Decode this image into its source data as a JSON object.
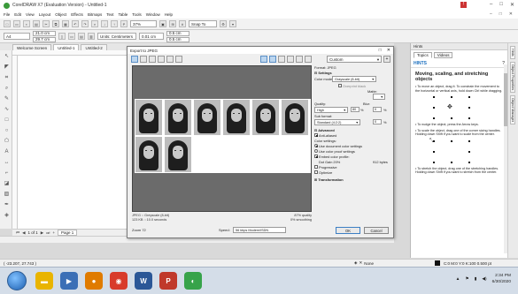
{
  "window": {
    "title": "CorelDRAW X7 (Evaluation Version) - Untitled-1",
    "controls": [
      "–",
      "□",
      "✕"
    ],
    "doc_controls": [
      "–",
      "□",
      "✕"
    ]
  },
  "menu": [
    "File",
    "Edit",
    "View",
    "Layout",
    "Object",
    "Effects",
    "Bitmaps",
    "Text",
    "Table",
    "Tools",
    "Window",
    "Help"
  ],
  "toolbar": {
    "zoom": "37%",
    "snap_to": "Snap To",
    "page_size": "A4",
    "width": "21.0 cm",
    "height": "29.7 cm",
    "units": "Units: Centimeters",
    "nudge": "0.01 cm",
    "dup_x": "0.5 cm",
    "dup_y": "0.5 cm"
  },
  "doc_tabs": [
    "Welcome Screen",
    "Untitled-1",
    "Untitled-2"
  ],
  "page_nav": {
    "position": "1 of 1",
    "page_tab": "Page 1"
  },
  "status": {
    "coords": "( -23.207, 27.743 )",
    "fill": "None",
    "outline": "C:0 M:0 Y:0 K:100 0.500 pt"
  },
  "hints": {
    "panel_title": "Hints",
    "tabs": [
      "Topics",
      "Videos"
    ],
    "section": "HINTS",
    "heading": "Moving, scaling, and stretching objects",
    "paragraphs": [
      "• To move an object, drag it. To constrain the movement to the horizontal or vertical axis, hold down Ctrl while dragging.",
      "• To nudge the object, press the Arrow keys.",
      "• To scale the object, drag one of the corner sizing handles. Holding down Shift if you want to scale from the center.",
      "• To stretch the object, drag one of the stretching handles. Holding down Shift if you want to stretch from the center."
    ],
    "docker_tabs": [
      "Hints",
      "Object Properties",
      "Object Manager"
    ]
  },
  "dialog": {
    "title": "Export to JPEG",
    "controls": [
      "□",
      "✕"
    ],
    "preset": "Custom",
    "preview_info_left": [
      "JPEG :: Greyscale (8-bit)",
      "123 KB :: 10.0 seconds"
    ],
    "preview_info_right": [
      "87% quality",
      "0% smoothing"
    ],
    "zoom": "Zoom 72",
    "speed_label": "Speed:",
    "speed_value": "56 kbps Modem/ISDN",
    "ok": "OK",
    "cancel": "Cancel",
    "settings": {
      "format": "Format: JPEG",
      "section_settings": "Settings",
      "color_mode_label": "Color mode:",
      "color_mode": "Grayscale (8-bit)",
      "overprint_black": "Overprint black",
      "matte": "Matte:",
      "quality_label": "Quality:",
      "quality": "High",
      "quality_value": "80",
      "blur_label": "Blur:",
      "blur_value": "0",
      "pct": "%",
      "sub_format_label": "Sub format:",
      "sub_format": "Standard (4:2:2)",
      "section_advanced": "Advanced",
      "anti_aliased": "Anti-aliased",
      "color_settings": "Color settings:",
      "use_document": "Use document color settings",
      "use_proof": "Use color proof settings",
      "embed_profile": "Embed color profile:",
      "dot_gain": "Dot Gain 20%",
      "dot_gain_size": "912 bytes",
      "progressive": "Progressive",
      "optimize": "Optimize",
      "section_transformation": "Transformation"
    }
  },
  "taskbar": {
    "time": "2:34 PM",
    "date": "6/30/2020"
  }
}
